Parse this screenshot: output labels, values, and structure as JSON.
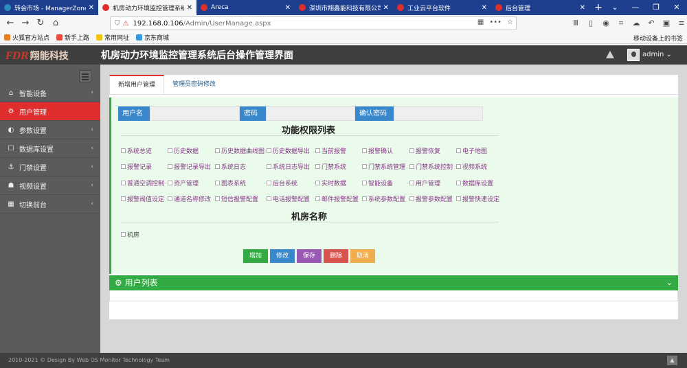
{
  "browser": {
    "tabs": [
      {
        "label": "转会市场 - ManagerZone",
        "color": "#2e8bc0",
        "active": false
      },
      {
        "label": "机房动力环境监控管理系统",
        "color": "#e02d2d",
        "active": true
      },
      {
        "label": "Areca",
        "color": "#e02d2d",
        "active": false
      },
      {
        "label": "深圳市翔鑫能科技有限公司",
        "color": "#e02d2d",
        "active": false
      },
      {
        "label": "工业云平台软件",
        "color": "#e02d2d",
        "active": false
      },
      {
        "label": "后台管理",
        "color": "#e02d2d",
        "active": false
      }
    ],
    "url_host": "192.168.0.106",
    "url_path": "/Admin/UserManage.aspx",
    "bookmarks": [
      "火狐官方站点",
      "新手上路",
      "常用网址",
      "京东商城"
    ],
    "mobile_bookmarks": "移动设备上的书签"
  },
  "app": {
    "logo_text": "翔能科技",
    "logo_mark": "FDR",
    "title": "机房动力环境监控管理系统后台操作管理界面",
    "user": "admin"
  },
  "sidebar": {
    "items": [
      {
        "label": "智能设备",
        "icon": "⌂",
        "icon_name": "home-icon",
        "active": false
      },
      {
        "label": "用户管理",
        "icon": "⚙",
        "icon_name": "cogs-icon",
        "active": true
      },
      {
        "label": "参数设置",
        "icon": "◐",
        "icon_name": "adjust-icon",
        "active": false
      },
      {
        "label": "数据库设置",
        "icon": "☐",
        "icon_name": "bookmark-icon",
        "active": false
      },
      {
        "label": "门禁设置",
        "icon": "⚓",
        "icon_name": "anchor-icon",
        "active": false
      },
      {
        "label": "视频设置",
        "icon": "☗",
        "icon_name": "sitemap-icon",
        "active": false
      },
      {
        "label": "切换前台",
        "icon": "▦",
        "icon_name": "grid-icon",
        "active": false
      }
    ]
  },
  "main": {
    "tabs": [
      "新增用户管理",
      "管理员密码修改"
    ],
    "fields": {
      "username_label": "用户名",
      "password_label": "密码",
      "confirm_label": "确认密码"
    },
    "perm_title": "功能权限列表",
    "permissions": [
      [
        "系统总览",
        "历史数据",
        "历史数据曲线图",
        "历史数据导出",
        "当前报警",
        "报警确认",
        "报警恢复",
        "电子地图"
      ],
      [
        "报警记录",
        "报警记录导出",
        "系统日志",
        "系统日志导出",
        "门禁系统",
        "门禁系统管理",
        "门禁系统控制",
        "视频系统"
      ],
      [
        "普通空调控制",
        "资产管理",
        "图表系统",
        "后台系统",
        "实时数据",
        "智能设备",
        "用户管理",
        "数据库设置"
      ],
      [
        "报警阀值设定",
        "通道名称修改",
        "短信报警配置",
        "电话报警配置",
        "邮件报警配置",
        "系统参数配置",
        "报警参数配置",
        "报警快速设定"
      ]
    ],
    "room_title": "机房名称",
    "rooms": [
      "机房"
    ],
    "buttons": [
      {
        "label": "增加",
        "color": "#33aa44"
      },
      {
        "label": "修改",
        "color": "#3a88cc"
      },
      {
        "label": "保存",
        "color": "#9b59b6"
      },
      {
        "label": "删除",
        "color": "#d9534f"
      },
      {
        "label": "取消",
        "color": "#f0ad4e"
      }
    ],
    "list_title": "用户列表"
  },
  "footer": {
    "text": "2010-2021 © Design By Web OS Monitor Technology Team"
  }
}
